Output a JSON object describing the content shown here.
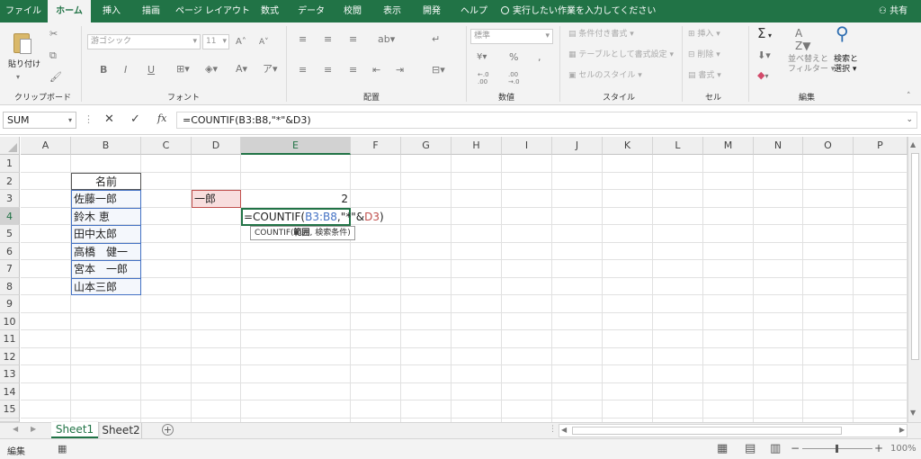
{
  "menu": {
    "tabs": [
      "ファイル",
      "ホーム",
      "挿入",
      "描画",
      "ページ レイアウト",
      "数式",
      "データ",
      "校閲",
      "表示",
      "開発",
      "ヘルプ"
    ],
    "tell_me": "実行したい作業を入力してください",
    "share": "共有"
  },
  "ribbon": {
    "clipboard": {
      "paste": "貼り付け",
      "label": "クリップボード"
    },
    "font": {
      "name": "游ゴシック",
      "size": "11",
      "label": "フォント"
    },
    "alignment": {
      "label": "配置"
    },
    "number": {
      "format": "標準",
      "label": "数値"
    },
    "styles": {
      "conditional": "条件付き書式",
      "table": "テーブルとして書式設定",
      "cell": "セルのスタイル",
      "label": "スタイル"
    },
    "cells": {
      "insert": "挿入",
      "delete": "削除",
      "format": "書式",
      "label": "セル"
    },
    "editing": {
      "sort": "並べ替えと",
      "filter": "フィルター",
      "find": "検索と",
      "select": "選択",
      "label": "編集"
    }
  },
  "formula_bar": {
    "name_box": "SUM",
    "fx": "fx",
    "formula": "=COUNTIF(B3:B8,\"*\"&D3)"
  },
  "columns": [
    "A",
    "B",
    "C",
    "D",
    "E",
    "F",
    "G",
    "H",
    "I",
    "J",
    "K",
    "L",
    "M",
    "N",
    "O",
    "P"
  ],
  "rows": [
    "1",
    "2",
    "3",
    "4",
    "5",
    "6",
    "7",
    "8",
    "9",
    "10",
    "11",
    "12",
    "13",
    "14",
    "15",
    "16"
  ],
  "cells": {
    "B2": "名前",
    "B3": "佐藤一郎",
    "B4": "鈴木 恵",
    "B5": "田中太郎",
    "B6": "高橋　健一",
    "B7": "宮本　一郎",
    "B8": "山本三郎",
    "D3": "一郎",
    "E3": "2"
  },
  "edit_formula": {
    "p1": "=COUNTIF(",
    "p2": "B3:B8",
    "p3": ",\"*\"&",
    "p4": "D3",
    "p5": ")"
  },
  "tooltip": {
    "p1": "COUNTIF(",
    "p2": "範囲",
    ", ": ", ",
    "p3": "検索条件",
    ")": ")"
  },
  "sheets": [
    "Sheet1",
    "Sheet2"
  ],
  "status": {
    "mode": "編集",
    "zoom": "100%"
  },
  "colors": {
    "accent": "#217346",
    "range_blue": "#4472c4",
    "ref_red": "#c0504d"
  }
}
